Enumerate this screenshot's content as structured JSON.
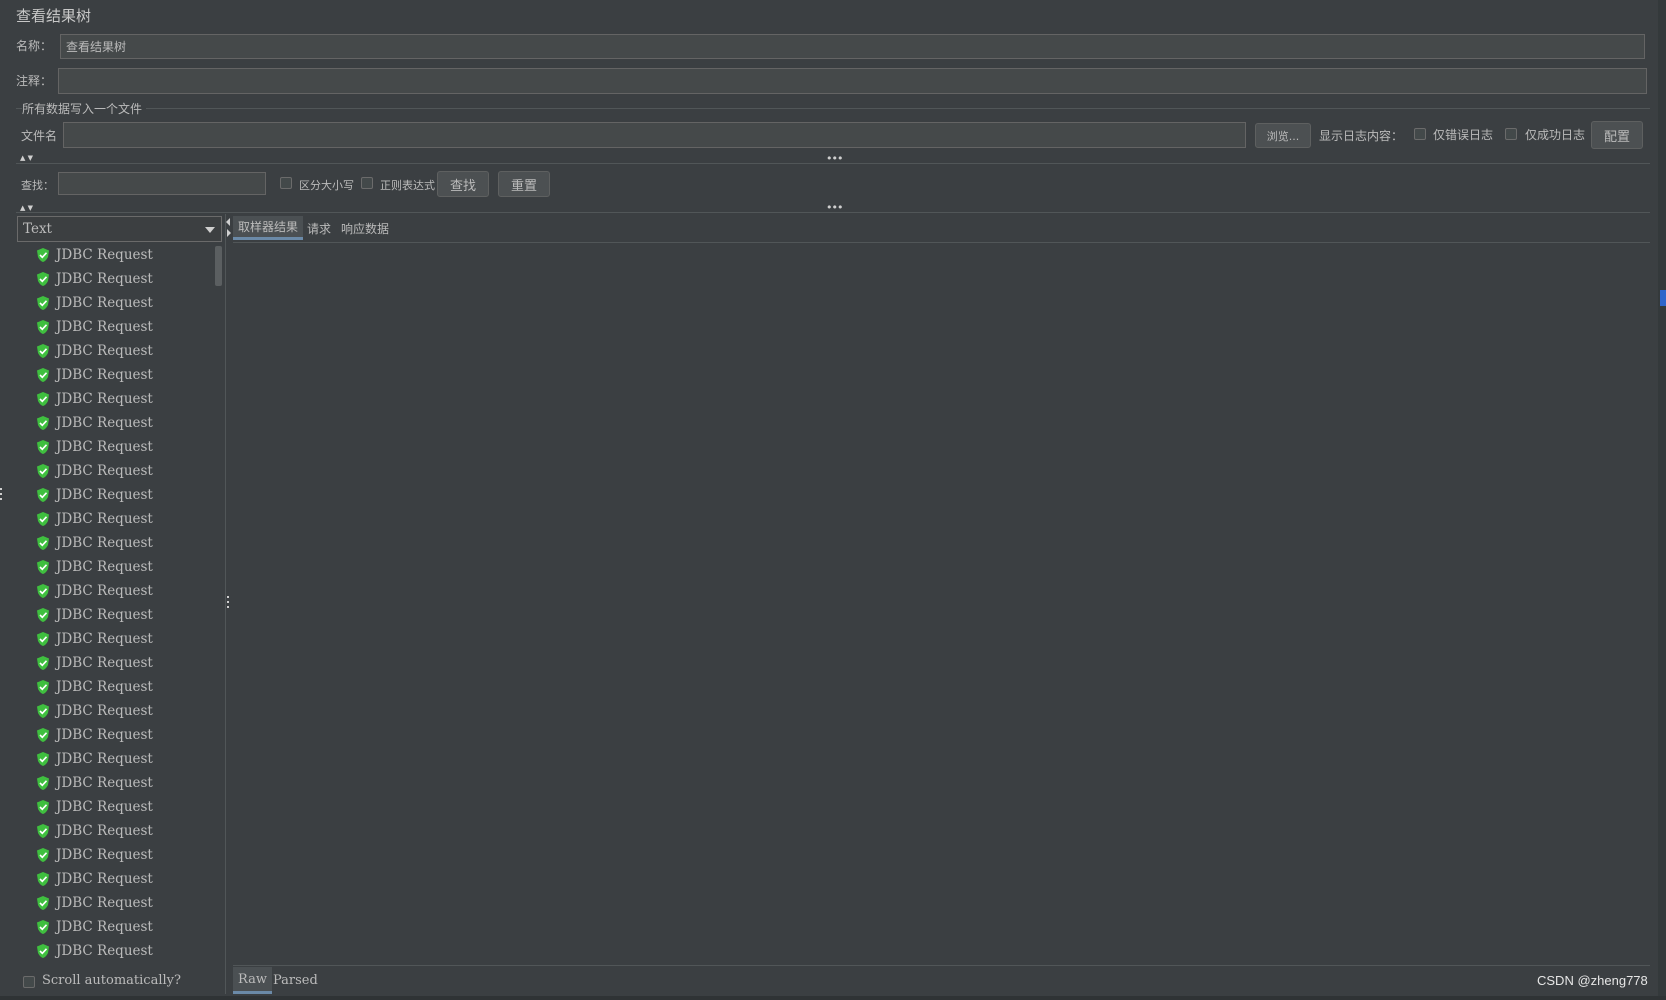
{
  "panel": {
    "title": "查看结果树"
  },
  "form": {
    "name_label": "名称：",
    "name_value": "查看结果树",
    "comment_label": "注释：",
    "comment_value": ""
  },
  "file_section": {
    "legend": "所有数据写入一个文件",
    "filename_label": "文件名",
    "filename_value": "",
    "browse_button": "浏览...",
    "log_content_label": "显示日志内容：",
    "errors_only_label": "仅错误日志",
    "errors_only_checked": false,
    "success_only_label": "仅成功日志",
    "success_only_checked": false,
    "configure_button": "配置"
  },
  "search": {
    "label": "查找：",
    "value": "",
    "case_sensitive_label": "区分大小写",
    "case_sensitive_checked": false,
    "regex_label": "正则表达式",
    "regex_checked": false,
    "find_button": "查找",
    "reset_button": "重置"
  },
  "renderer": {
    "selected": "Text"
  },
  "tree": {
    "items": [
      "JDBC Request",
      "JDBC Request",
      "JDBC Request",
      "JDBC Request",
      "JDBC Request",
      "JDBC Request",
      "JDBC Request",
      "JDBC Request",
      "JDBC Request",
      "JDBC Request",
      "JDBC Request",
      "JDBC Request",
      "JDBC Request",
      "JDBC Request",
      "JDBC Request",
      "JDBC Request",
      "JDBC Request",
      "JDBC Request",
      "JDBC Request",
      "JDBC Request",
      "JDBC Request",
      "JDBC Request",
      "JDBC Request",
      "JDBC Request",
      "JDBC Request",
      "JDBC Request",
      "JDBC Request",
      "JDBC Request",
      "JDBC Request",
      "JDBC Request"
    ],
    "status_color": "#3fbf3f",
    "scroll_auto_label": "Scroll automatically?",
    "scroll_auto_checked": false
  },
  "result_tabs": {
    "tabs": [
      "取样器结果",
      "请求",
      "响应数据"
    ],
    "active": "取样器结果"
  },
  "bottom_tabs": {
    "tabs": [
      "Raw",
      "Parsed"
    ],
    "active": "Raw"
  },
  "watermark": "CSDN @zheng778",
  "colors": {
    "accent": "#6b8aa8",
    "background": "#3b3f42",
    "success": "#3fbf3f"
  }
}
